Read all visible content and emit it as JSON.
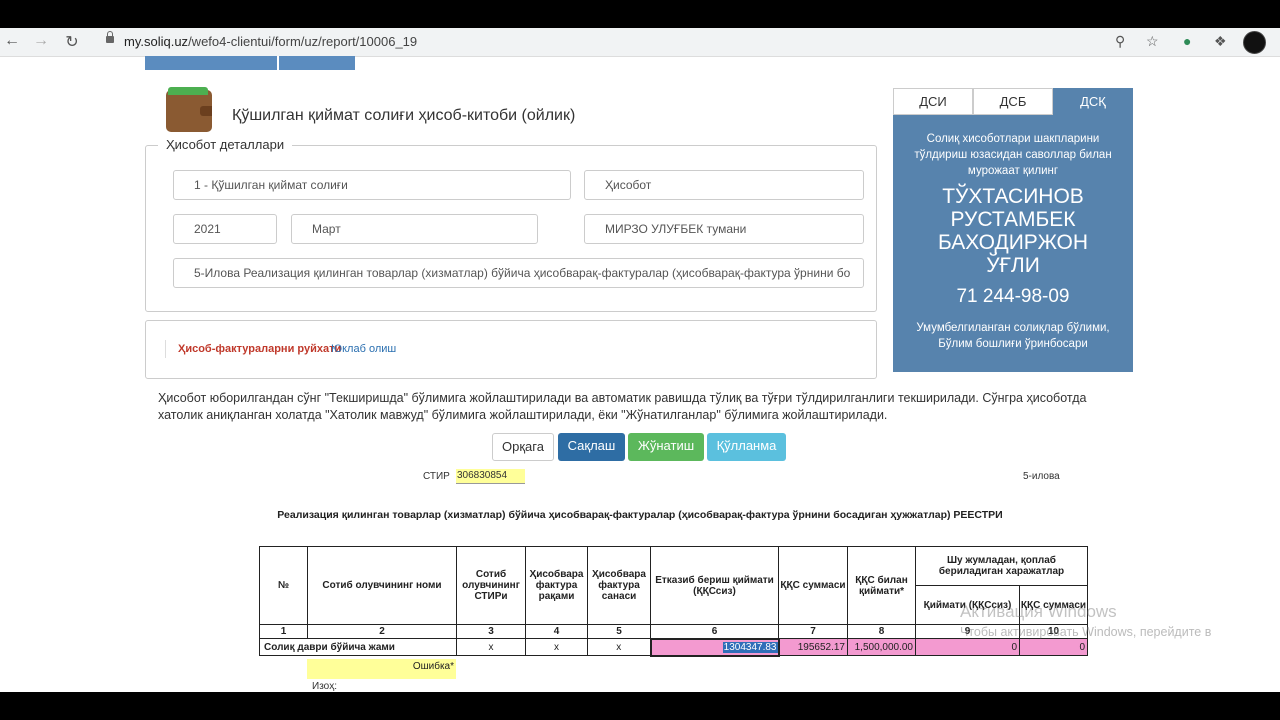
{
  "browser": {
    "url_domain": "my.soliq.uz",
    "url_path": "/wefo4-clientui/form/uz/report/10006_19"
  },
  "form": {
    "title": "Қўшилган қиймат солиғи ҳисоб-китоби (ойлик)",
    "details_legend": "Ҳисобот деталлари",
    "tax_type": "1 - Қўшилган қиймат солиғи",
    "report_kind": "Ҳисобот",
    "year": "2021",
    "month": "Март",
    "district": "МИРЗО УЛУҒБЕК тумани",
    "appendix": "5-Илова Реализация қилинган товарлар (хизматлар) бўйича ҳисобварақ-фактуралар (ҳисобварақ-фактура ўрнини бо",
    "invoices_list_label": "Ҳисоб-фактураларни руйхати",
    "download_label": "Юклаб олиш",
    "notice": "Ҳисобот юборилгандан сўнг \"Текширишда\" бўлимига жойлаштирилади ва автоматик равишда тўлиқ ва тўғри тўлдирилганлиги текширилади. Сўнгра ҳисоботда хатолик аниқланган холатда \"Хатолик мавжуд\" бўлимига жойлаштирилади, ёки \"Жўнатилганлар\" бўлимига жойлаштирилади."
  },
  "buttons": {
    "back": "Орқага",
    "save": "Сақлаш",
    "send": "Жўнатиш",
    "guide": "Қўлланма"
  },
  "panel": {
    "tabs": [
      "ДСИ",
      "ДСБ",
      "ДСҚ"
    ],
    "active_tab": "ДСҚ",
    "intro": "Солиқ хисоботлари шакпларини тўлдириш юзасидан саволлар билан мурожаат қилинг",
    "name": "ТЎХТАСИНОВ РУСТАМБЕК БАХОДИРЖОН ЎҒЛИ",
    "phone": "71 244-98-09",
    "position": "Умумбелгиланган солиқлар бўлими, Бўлим бошлиғи ўринбосари"
  },
  "report": {
    "stir_label": "СТИР",
    "stir_value": "306830854",
    "appendix_label": "5-илова",
    "heading": "Реализация қилинган товарлар (хизматлар) бўйича ҳисобварақ-фактуралар (ҳисобварақ-фактура ўрнини босадиган ҳужжатлар) РЕЕСТРИ",
    "columns": {
      "num": "№",
      "buyer_name": "Сотиб олувчининг номи",
      "buyer_stir": "Сотиб олувчининг СТИРи",
      "inv_number": "Ҳисобвара фактура рақами",
      "inv_date": "Ҳисобвара фактура санаси",
      "supply_value": "Етказиб бериш қиймати (ҚҚСсиз)",
      "vat_sum": "ҚҚС суммаси",
      "with_vat": "ҚҚС билан қиймати*",
      "incl_header": "Шу жумладан, қоплаб бериладиган харажатлар",
      "incl_value": "Қиймати (ҚҚСсиз)",
      "incl_vat": "ҚҚС суммаси"
    },
    "col_numbers": [
      "1",
      "2",
      "3",
      "4",
      "5",
      "6",
      "7",
      "8",
      "9",
      "10"
    ],
    "total_row": {
      "label": "Солиқ даври бўйича жами",
      "x1": "x",
      "x2": "x",
      "x3": "x",
      "supply": "1304347.83",
      "vat": "195652.17",
      "with_vat": "1,500,000.00",
      "incl_value": "0",
      "incl_vat": "0"
    },
    "error_label": "Ошибка*",
    "note_label": "Изоҳ:"
  },
  "watermark": {
    "line1": "Активация Windows",
    "line2": "Чтобы активировать Windows, перейдите в"
  }
}
